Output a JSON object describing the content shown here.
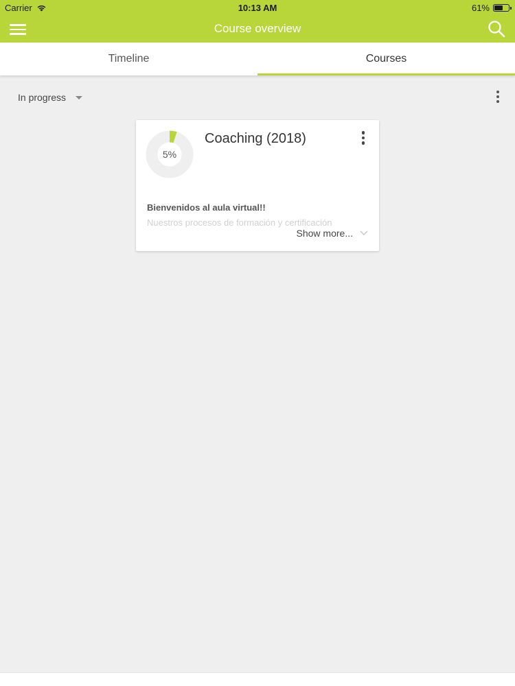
{
  "status_bar": {
    "carrier": "Carrier",
    "time": "10:13 AM",
    "battery": "61%",
    "battery_level": 0.61
  },
  "header": {
    "title": "Course overview",
    "menu_icon": "hamburger-menu-icon",
    "search_icon": "search-icon",
    "accent_color": "#b8d53a"
  },
  "tabs": [
    {
      "label": "Timeline",
      "active": false
    },
    {
      "label": "Courses",
      "active": true
    }
  ],
  "filter": {
    "selected": "In progress"
  },
  "courses": [
    {
      "title": "Coaching (2018)",
      "progress_label": "5%",
      "progress": 0.05,
      "summary_heading": "Bienvenidos al aula virtual!!",
      "summary_text": "Nuestros procesos de formación y certificación",
      "show_more": "Show more..."
    }
  ]
}
